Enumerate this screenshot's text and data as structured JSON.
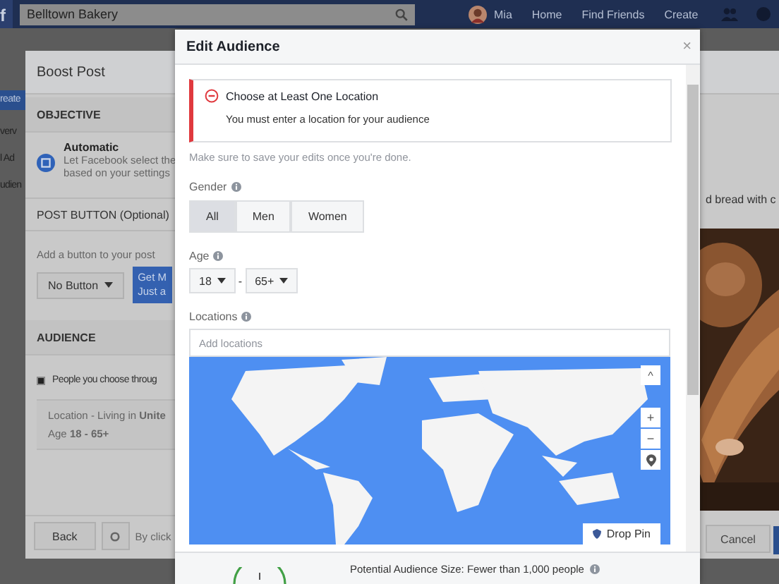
{
  "top_bar": {
    "logo": "f",
    "search": "Belltown Bakery",
    "user": "Mia",
    "links": [
      "Home",
      "Find Friends",
      "Create"
    ]
  },
  "left_strip": {
    "button": "reate",
    "fragments": [
      "verv",
      "l Ad",
      "udien"
    ]
  },
  "boost_post": {
    "title": "Boost Post",
    "objective": {
      "heading": "OBJECTIVE",
      "option": "Automatic",
      "description": [
        "Let Facebook select the",
        "based on your settings"
      ]
    },
    "post_button": {
      "heading": "POST BUTTON (Optional)",
      "hint": "Add a button to your post",
      "select": "No Button",
      "tooltip": [
        "Get M",
        "Just a"
      ]
    },
    "audience": {
      "heading": "AUDIENCE",
      "option": "People you choose throug",
      "selected": true,
      "location": "Location - Living in **Unite**",
      "age": "Age **18 - 65+**"
    },
    "preview": {
      "caption": "d bread with c",
      "kind": "picture"
    },
    "footer": {
      "back": "Back",
      "terms": "By click",
      "cancel": "Cancel"
    }
  },
  "edit_audience": {
    "title": "Edit Audience",
    "close": "×",
    "error": {
      "title": "Choose at Least One Location",
      "message": "You must enter a location for your audience"
    },
    "note": "Make sure to save your edits once you're done.",
    "gender": {
      "label": "Gender",
      "options": [
        {
          "label": "All",
          "selected": true
        },
        {
          "label": "Men",
          "selected": false
        },
        {
          "label": "Women",
          "selected": false
        }
      ]
    },
    "age": {
      "label": "Age",
      "min": "18",
      "separator": "-",
      "max": "65+"
    },
    "locations": {
      "label": "Locations",
      "placeholder": "Add locations",
      "map": {
        "kind": "picture",
        "collapse": "^",
        "zoom_in": "+",
        "zoom_out": "−",
        "drop_pin": "Drop Pin"
      }
    },
    "footer": {
      "audience_size": "Potential Audience Size: Fewer than 1,000 people"
    }
  }
}
